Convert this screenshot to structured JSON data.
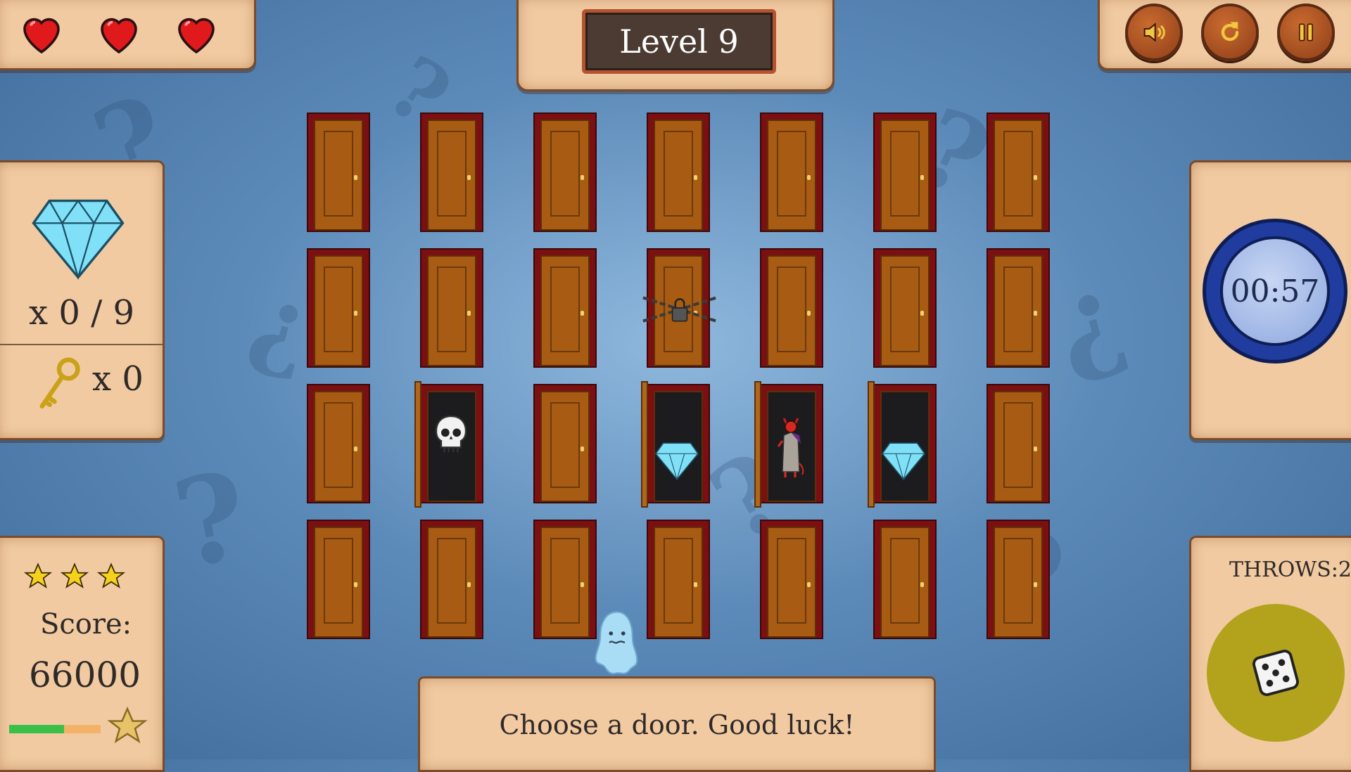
{
  "hud": {
    "lives": 3,
    "level_label": "Level 9",
    "sound_icon": "speaker-icon",
    "restart_icon": "restart-icon",
    "pause_icon": "pause-icon"
  },
  "stats": {
    "diamonds_text": "x 0 / 9",
    "keys_text": "x 0",
    "stars": 3,
    "score_label": "Score:",
    "score_value": "66000"
  },
  "timer": {
    "time": "00:57"
  },
  "dice": {
    "throws_label": "THROWS:2"
  },
  "message": {
    "text": "Choose a door. Good luck!"
  },
  "board": {
    "rows": [
      [
        "closed",
        "closed",
        "closed",
        "closed",
        "closed",
        "closed",
        "closed"
      ],
      [
        "closed",
        "closed",
        "closed",
        "locked",
        "closed",
        "closed",
        "closed"
      ],
      [
        "closed",
        "skull",
        "closed",
        "diamond",
        "devil",
        "diamond",
        "closed"
      ],
      [
        "closed",
        "closed",
        "closed",
        "closed",
        "closed",
        "closed",
        "closed"
      ]
    ]
  },
  "colors": {
    "heart": "#e0191c",
    "door_frame": "#7b0f12",
    "door_leaf": "#a85b12",
    "diamond": "#7fe0f7",
    "timer_ring": "#1f3c9e",
    "dice_button": "#b3a31c",
    "progress_green": "#3ac048",
    "progress_orange": "#f2b268",
    "star": "#f4d21c"
  }
}
